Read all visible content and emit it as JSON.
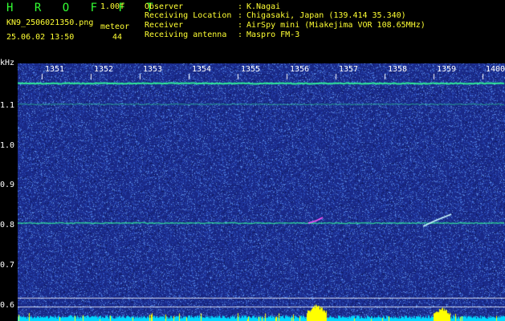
{
  "header": {
    "logo": "H R O F F T",
    "version": "1.00f",
    "filename": "KN9_2506021350.png",
    "meteor_label": "meteor",
    "datetime": "25.06.02 13:50",
    "count": "44"
  },
  "info": [
    {
      "label": "Observer",
      "value": "K.Nagai"
    },
    {
      "label": "Receiving Location",
      "value": "Chigasaki, Japan (139.414 35.340)"
    },
    {
      "label": "Receiver",
      "value": "AirSpy mini (Miakejima VOR 108.65MHz)"
    },
    {
      "label": "Receiving antenna",
      "value": "Maspro FM-3"
    }
  ],
  "spectrogram": {
    "y_unit": "kHz",
    "y_ticks": [
      "1.1",
      "1.0",
      "0.9",
      "0.8",
      "0.7",
      "0.6"
    ],
    "x_ticks": [
      "1351",
      "1352",
      "1353",
      "1354",
      "1355",
      "1356",
      "1357",
      "1358",
      "1359",
      "1400"
    ],
    "colors": {
      "background": "#1a2a8a",
      "trace": "#33ff99",
      "grid": "#ffffff",
      "level": "#00d8ff",
      "peak": "#ffff00"
    }
  }
}
